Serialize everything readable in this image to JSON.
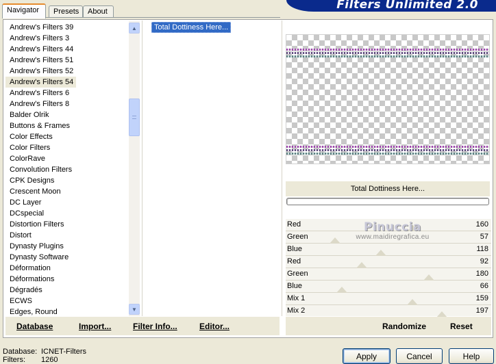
{
  "banner": {
    "title": "Filters Unlimited 2.0"
  },
  "tabs": [
    {
      "label": "Navigator",
      "active": true
    },
    {
      "label": "Presets",
      "active": false
    },
    {
      "label": "About",
      "active": false
    }
  ],
  "categories": {
    "items": [
      "Andrew's Filters 39",
      "Andrew's Filters 3",
      "Andrew's Filters 44",
      "Andrew's Filters 51",
      "Andrew's Filters 52",
      "Andrew's Filters 54",
      "Andrew's Filters 6",
      "Andrew's Filters 8",
      "Balder Olrik",
      "Buttons & Frames",
      "Color Effects",
      "Color Filters",
      "ColorRave",
      "Convolution Filters",
      "CPK Designs",
      "Crescent Moon",
      "DC Layer",
      "DCspecial",
      "Distortion Filters",
      "Distort",
      "Dynasty Plugins",
      "Dynasty Software",
      "Déformation",
      "Déformations",
      "Dégradés",
      "ECWS",
      "Edges, Round"
    ],
    "selected": "Andrew's Filters 54"
  },
  "filters": {
    "selected": "Total Dottiness Here..."
  },
  "preview": {
    "label": "Total Dottiness Here..."
  },
  "sliders": [
    {
      "label": "Red",
      "value": "160",
      "level": 0.627
    },
    {
      "label": "Green",
      "value": "57",
      "level": 0.224
    },
    {
      "label": "Blue",
      "value": "118",
      "level": 0.463
    },
    {
      "label": "Red",
      "value": "92",
      "level": 0.361
    },
    {
      "label": "Green",
      "value": "180",
      "level": 0.706
    },
    {
      "label": "Blue",
      "value": "66",
      "level": 0.259
    },
    {
      "label": "Mix 1",
      "value": "159",
      "level": 0.624
    },
    {
      "label": "Mix 2",
      "value": "197",
      "level": 0.773
    }
  ],
  "watermark": {
    "line1": "Pinuccia",
    "line2": "www.maidiregrafica.eu"
  },
  "toolbar_left": {
    "database": "Database",
    "import": "Import...",
    "filter_info": "Filter Info...",
    "editor": "Editor..."
  },
  "toolbar_right": {
    "randomize": "Randomize",
    "reset": "Reset"
  },
  "status": {
    "database_label": "Database:",
    "database_value": "ICNET-Filters",
    "filters_label": "Filters:",
    "filters_value": "1260"
  },
  "dialog": {
    "apply": "Apply",
    "cancel": "Cancel",
    "help": "Help"
  },
  "colors": {
    "banner": "#0a2a8c",
    "selection": "#316ac5",
    "tab_highlight": "#e68b2c"
  }
}
